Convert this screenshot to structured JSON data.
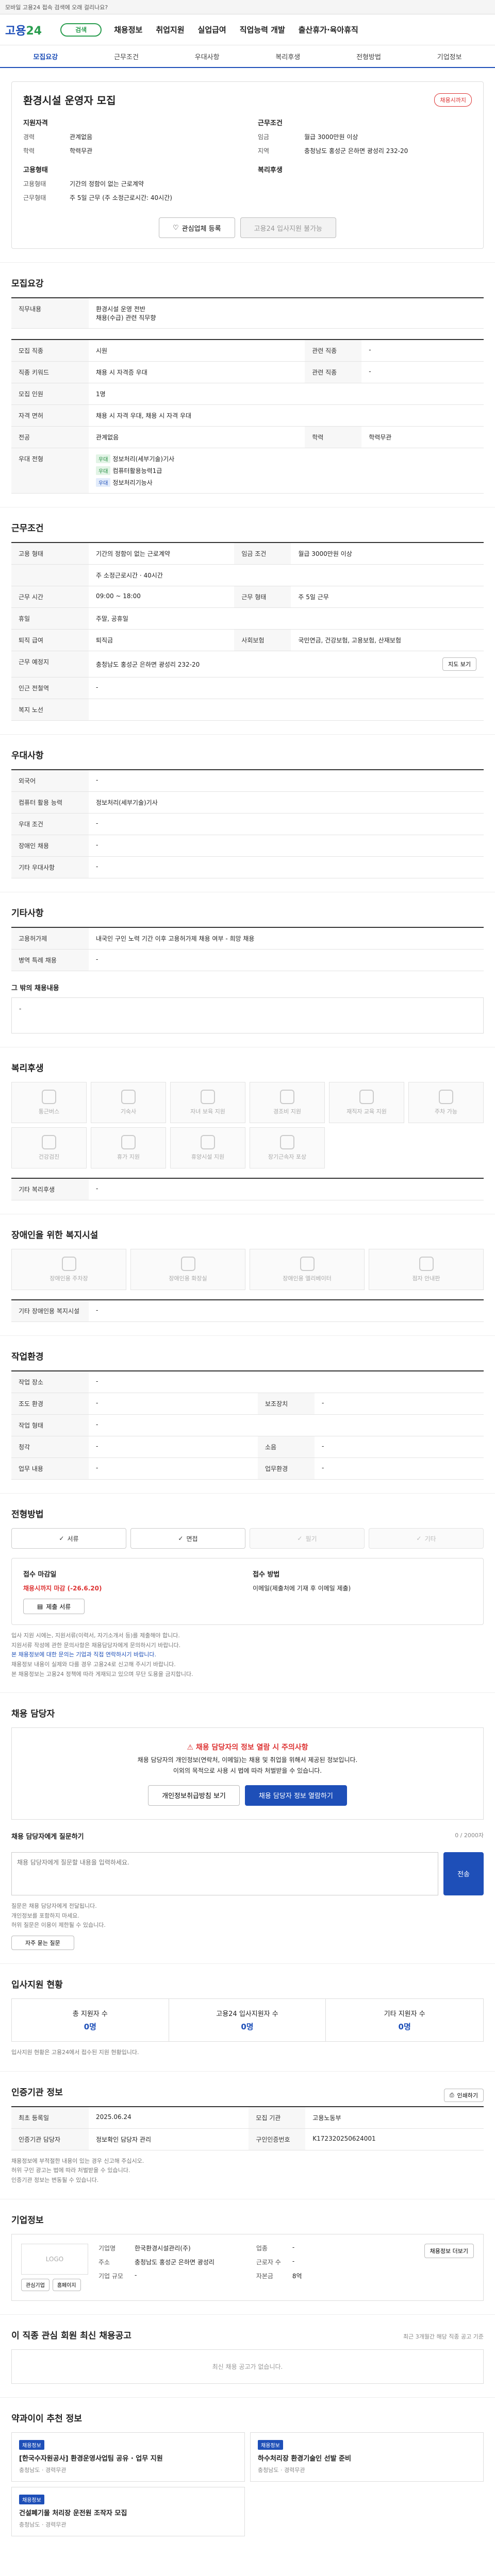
{
  "topbar": {
    "breadcrumb": "모바일 고용24 접속 검색에 오래 걸리나요?",
    "sep": "|"
  },
  "header": {
    "logo_main": "고용",
    "logo_num": "24",
    "nav": [
      "채용정보",
      "취업지원",
      "실업급여",
      "직업능력 개발",
      "출산휴가·육아휴직"
    ],
    "search_label": "검색"
  },
  "tabs": [
    "모집요강",
    "근무조건",
    "우대사항",
    "복리후생",
    "전형방법",
    "기업정보"
  ],
  "summary": {
    "title": "환경시설 운영자 모집",
    "badge": "채용시까지",
    "left_h": "지원자격",
    "left": [
      [
        "경력",
        "관계없음"
      ],
      [
        "학력",
        "학력무관"
      ]
    ],
    "right_h": "근무조건",
    "right": [
      [
        "임금",
        "월급 3000만원 이상"
      ],
      [
        "지역",
        "충청남도 홍성군 은하면 광성리 232-20"
      ]
    ],
    "left2_h": "고용형태",
    "left2": [
      [
        "고용형태",
        "기간의 정함이 없는 근로계약"
      ],
      [
        "근무형태",
        "주 5일 근무 (주 소정근로시간: 40시간)"
      ]
    ],
    "right2_h": "복리후생",
    "right2": [],
    "btn_apply": "관심업체 등록",
    "btn_contact": "고용24 입사지원 불가능"
  },
  "recruit": {
    "title": "모집요강",
    "duty_h": "직무내용",
    "duty": "환경시설 운영 전반\n채용(수급) 관련 직무향",
    "rows": [
      [
        "모집 직종",
        "시원",
        "관련 직종",
        "-"
      ],
      [
        "직종 키워드",
        "채용 시 자격증 우대",
        "관련 직종",
        "-"
      ],
      [
        "모집 인원",
        "1명",
        "",
        ""
      ],
      [
        "자격 면허",
        "채용 시 자격 우대, 채용 시 자격 우대",
        "",
        ""
      ],
      [
        "전공",
        "관계없음",
        "학력",
        "학력무관"
      ]
    ],
    "extra_h": "우대 전형",
    "extra": [
      [
        "우대",
        "정보처리(세부기술)기사"
      ],
      [
        "우대",
        "컴퓨터활용능력1급"
      ],
      [
        "우대",
        "정보처리기능사"
      ]
    ]
  },
  "work": {
    "title": "근무조건",
    "rows": [
      [
        "고용 형태",
        "기간의 정함이 없는 근로계약",
        "임금 조건",
        "월급 3000만원 이상"
      ],
      [
        "",
        "주 소정근로시간 · 40시간",
        "",
        ""
      ],
      [
        "근무 시간",
        "09:00 ~ 18:00",
        "근무 형태",
        "주 5일 근무"
      ],
      [
        "휴일",
        "주말, 공휴일",
        "",
        ""
      ],
      [
        "퇴직 급여",
        "퇴직금",
        "사회보험",
        "국민연금, 건강보험, 고용보험, 산재보험"
      ],
      [
        "근무 예정지",
        "충청남도 홍성군 은하면 광성리 232-20",
        "",
        ""
      ]
    ],
    "map_btn": "지도 보기",
    "notes": [
      "인근 전철역",
      "-",
      "복지 노선"
    ]
  },
  "prefer": {
    "title": "우대사항",
    "rows": [
      [
        "외국어",
        "-"
      ],
      [
        "컴퓨터 활용 능력",
        "정보처리(세부기술)기사"
      ],
      [
        "우대 조건",
        "-"
      ],
      [
        "장애인 채용",
        "-"
      ],
      [
        "기타 우대사항",
        "-"
      ]
    ]
  },
  "additional": {
    "title": "기타사항",
    "rows": [
      [
        "고용허가제",
        "내국인 구인 노력 기간 이후 고용허가제 채용 여부 - 희망 채용"
      ],
      [
        "병역 특례 채용",
        "-"
      ]
    ],
    "note_h": "그 밖의 채용내용",
    "note": "-"
  },
  "welfare": {
    "title": "복리후생",
    "tiles": [
      "통근버스",
      "기숙사",
      "자녀 보육 지원",
      "경조비 지원",
      "재직자 교육 지원",
      "주차 가능",
      "건강검진",
      "휴가 지원",
      "휴양시설 지원",
      "장기근속자 포상"
    ],
    "other_h": "기타 복리후생",
    "other": "-"
  },
  "disabled": {
    "title": "장애인을 위한 복지시설",
    "tiles": [
      "장애인용 주차장",
      "장애인용 화장실",
      "장애인용 엘리베이터",
      "점자 안내판"
    ],
    "other_h": "기타 장애인용 복지시설",
    "other": "-"
  },
  "env": {
    "title": "작업환경",
    "rows": [
      [
        "작업 장소",
        "-",
        "",
        ""
      ],
      [
        "조도 환경",
        "-",
        "보조장치",
        "-"
      ],
      [
        "작업 형태",
        "-",
        "",
        ""
      ],
      [
        "청각",
        "-",
        "소음",
        "-"
      ],
      [
        "업무 내용",
        "-",
        "업무환경",
        "-"
      ]
    ]
  },
  "method": {
    "title": "전형방법",
    "methods": [
      "서류",
      "면접",
      "필기",
      "기타"
    ],
    "method_on": [
      true,
      true,
      false,
      false
    ],
    "doc_h": "접수 마감일",
    "doc": "채용시까지 마감 (-26.6.20)",
    "docs_h": "접수 방법",
    "docs": "이메일(제출처에 기재 후 이메일 제출)",
    "submit_btn": "제출 서류",
    "notes": [
      "입사 지원 시에는, 지원서류(이력서, 자기소개서 등)를 제출해야 합니다.",
      "지원서류 작성에 관한 문의사항은 채용담당자에게 문의하시기 바랍니다.",
      "본 채용정보에 대한 문의는 기업과 직접 연락하시기 바랍니다.",
      "채용정보 내용이 실제와 다를 경우 고용24로 신고해 주시기 바랍니다.",
      "본 채용정보는 고용24 정책에 따라 게재되고 있으며 무단 도용을 금지합니다."
    ]
  },
  "contact": {
    "title": "채용 담당자",
    "alert_h": "채용 담당자의 정보 열람 시 주의사항",
    "alert_lines": [
      "채용 담당자의 개인정보(연락처, 이메일)는 채용 및 취업을 위해서 제공된 정보입니다.",
      "이외의 목적으로 사용 시 법에 따라 처벌받을 수 있습니다."
    ],
    "btn1": "개인정보취급방침 보기",
    "btn2": "채용 담당자 정보 열람하기",
    "qa_h": "채용 담당자에게 질문하기",
    "qa_placeholder": "채용 담당자에게 질문할 내용을 입력하세요.",
    "qa_counter": "0 / 2000자",
    "qa_btn": "전송",
    "qa_notes": [
      "질문은 채용 담당자에게 전달됩니다.",
      "개인정보를 포함하지 마세요.",
      "허위 질문은 이용이 제한될 수 있습니다."
    ],
    "faq_btn": "자주 묻는 질문"
  },
  "apply_status": {
    "title": "입사지원 현황",
    "stats": [
      [
        "총 지원자 수",
        "0명"
      ],
      [
        "고용24 입사지원자 수",
        "0명"
      ],
      [
        "기타 지원자 수",
        "0명"
      ]
    ],
    "note": "입사지원 현황은 고용24에서 접수된 지원 현황입니다."
  },
  "info": {
    "title": "인증기관 정보",
    "print_btn": "인쇄하기",
    "rows": [
      [
        "최초 등록일",
        "2025.06.24",
        "모집 기관",
        "고용노동부"
      ],
      [
        "인증기관 담당자",
        "정보확인 담당자 관리",
        "구인인증번호",
        "K172320250624001"
      ]
    ],
    "notes": [
      "채용정보에 부적절한 내용이 있는 경우 신고해 주십시오.",
      "허위 구인 광고는 법에 따라 처벌받을 수 있습니다.",
      "인증기관 정보는 변동될 수 있습니다."
    ]
  },
  "company": {
    "title": "기업정보",
    "logo": "LOGO",
    "btn1": "관심기업",
    "btn2": "홈페이지",
    "rows": [
      [
        "기업명",
        "한국환경시설관리(주)",
        "업종",
        "-"
      ],
      [
        "주소",
        "충청남도 홍성군 은하면 광성리",
        "근로자 수",
        "-"
      ],
      [
        "기업 규모",
        "-",
        "자본금",
        "8억"
      ]
    ],
    "more_btn": "채용정보 더보기"
  },
  "similar": {
    "title": "이 직종 관심 회원 최신 채용공고",
    "sub": "최근 3개월간 해당 직종 공고 기준",
    "empty": "최신 채용 공고가 없습니다."
  },
  "recommend": {
    "title": "약과이이 추천 정보",
    "cards": [
      {
        "tag": "채용정보",
        "t": "[한국수자원공사] 환경운영사업팀 공유 · 업무 지원",
        "meta": "충청남도 · 경력무관"
      },
      {
        "tag": "채용정보",
        "t": "하수처리장 환경기술인 선발 준비",
        "meta": "충청남도 · 경력무관"
      },
      {
        "tag": "채용정보",
        "t": "건설폐기물 처리장 운전원 조작자 모집",
        "meta": "충청남도 · 경력무관"
      }
    ]
  }
}
